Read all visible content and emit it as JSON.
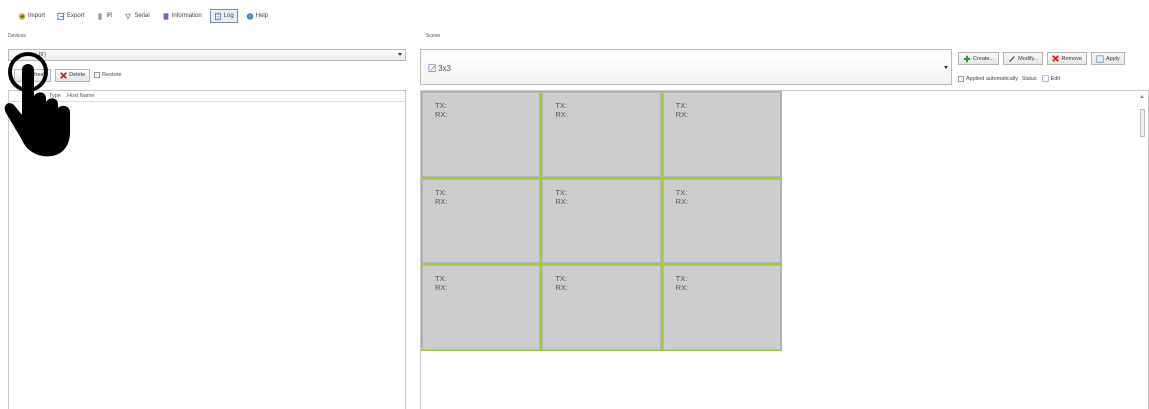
{
  "toolbar": {
    "items": [
      {
        "label": "Import",
        "icon": "import-icon"
      },
      {
        "label": "Export",
        "icon": "export-icon"
      },
      {
        "label": "IR",
        "icon": "ir-icon"
      },
      {
        "label": "Serial",
        "icon": "serial-icon"
      },
      {
        "label": "Information",
        "icon": "information-icon"
      },
      {
        "label": "Log",
        "icon": "log-icon",
        "active": true
      },
      {
        "label": "Help",
        "icon": "help-icon"
      }
    ]
  },
  "devices": {
    "section_label": "Devices",
    "selector_value": "ltr)",
    "refresh_label": "Refresh",
    "delete_label": "Delete",
    "restore_label": "Restore",
    "columns": [
      "Type",
      "Host Name"
    ]
  },
  "scene": {
    "section_label": "Scene",
    "selected_name": "3x3",
    "create_label": "Create...",
    "modify_label": "Modify...",
    "remove_label": "Remove",
    "apply_label": "Apply",
    "applied_auto_label": "Applied automatically",
    "status_label": "Status:",
    "edit_label": "Edit",
    "cells": [
      {
        "tx": "TX:",
        "rx": "RX:"
      },
      {
        "tx": "TX:",
        "rx": "RX:"
      },
      {
        "tx": "TX:",
        "rx": "RX:"
      },
      {
        "tx": "TX:",
        "rx": "RX:"
      },
      {
        "tx": "TX:",
        "rx": "RX:"
      },
      {
        "tx": "TX:",
        "rx": "RX:"
      },
      {
        "tx": "TX:",
        "rx": "RX:"
      },
      {
        "tx": "TX:",
        "rx": "RX:"
      },
      {
        "tx": "TX:",
        "rx": "RX:"
      }
    ]
  },
  "colors": {
    "cell_bg": "#cdcdcd",
    "cell_border": "#9fcc3b",
    "active_tab": "#e8eef6"
  }
}
